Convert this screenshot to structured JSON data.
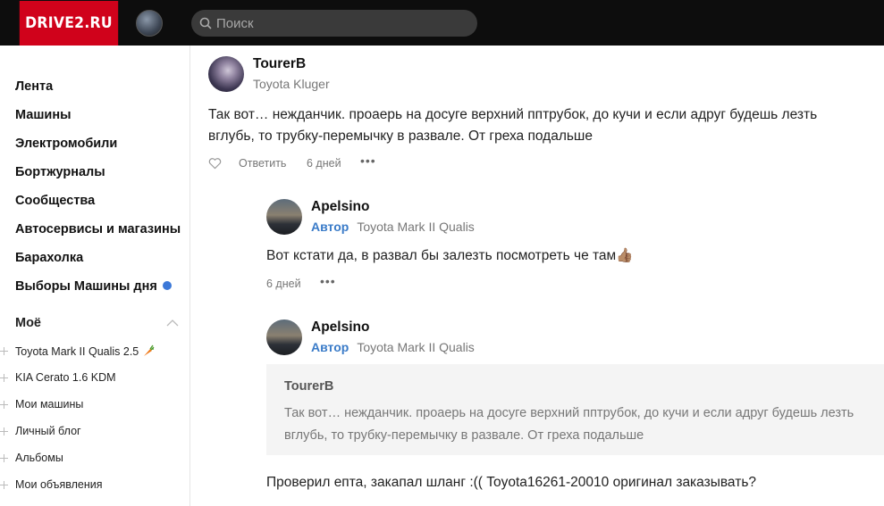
{
  "header": {
    "logo": "DRIVE2.RU",
    "search_placeholder": "Поиск",
    "colors": {
      "bar": "#0d0d0d",
      "logo_bg": "#d0021b"
    }
  },
  "sidebar": {
    "items": [
      {
        "label": "Лента"
      },
      {
        "label": "Машины"
      },
      {
        "label": "Электромобили"
      },
      {
        "label": "Бортжурналы"
      },
      {
        "label": "Сообщества"
      },
      {
        "label": "Автосервисы и магазины"
      },
      {
        "label": "Барахолка"
      },
      {
        "label": "Выборы Машины дня"
      }
    ],
    "my_title": "Моё",
    "my_items": [
      {
        "label": "Toyota Mark II Qualis 2.5"
      },
      {
        "label": "KIA Cerato 1.6 KDM"
      },
      {
        "label": "Мои машины"
      },
      {
        "label": "Личный блог"
      },
      {
        "label": "Альбомы"
      },
      {
        "label": "Мои объявления"
      }
    ]
  },
  "comments": [
    {
      "user": "TourerB",
      "car": "Toyota Kluger",
      "text_line1": "Так вот… нежданчик. проаерь на досуге верхний пптрубок, до кучи и если адруг будешь лезть",
      "text_line2": "вглубь, то трубку-перемычку в развале. От греха подальше",
      "reply": "Ответить",
      "time": "6 дней"
    },
    {
      "user": "Apelsino",
      "badge": "Автор",
      "car": "Toyota Mark II Qualis",
      "text": "Вот кстати да, в развал бы залезть посмотреть че там",
      "emoji": "👍🏽",
      "time": "6 дней"
    },
    {
      "user": "Apelsino",
      "badge": "Автор",
      "car": "Toyota Mark II Qualis",
      "quote_user": "TourerB",
      "quote_line1": "Так вот… нежданчик. проаерь на досуге верхний пптрубок, до кучи и если адруг будешь лезть",
      "quote_line2": "вглубь, то трубку-перемычку в развале. От греха подальше",
      "text": "Проверил епта, закапал шланг :(( Toyota16261-20010 оригинал заказывать?"
    }
  ]
}
